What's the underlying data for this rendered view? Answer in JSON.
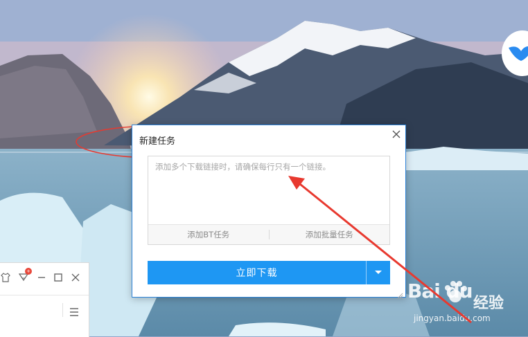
{
  "dialog": {
    "title": "新建任务",
    "input_placeholder": "添加多个下载链接时，请确保每行只有一个链接。",
    "add_bt_label": "添加BT任务",
    "add_batch_label": "添加批量任务",
    "download_label": "立即下载"
  },
  "side_window": {
    "badge": "+"
  },
  "watermark": {
    "brand": "Bai du",
    "brand_cn": "经验",
    "url": "jingyan.baidu.com"
  },
  "colors": {
    "accent": "#1e97f3",
    "dialog_border": "#2d83d9",
    "annotation_red": "#e8392f"
  }
}
